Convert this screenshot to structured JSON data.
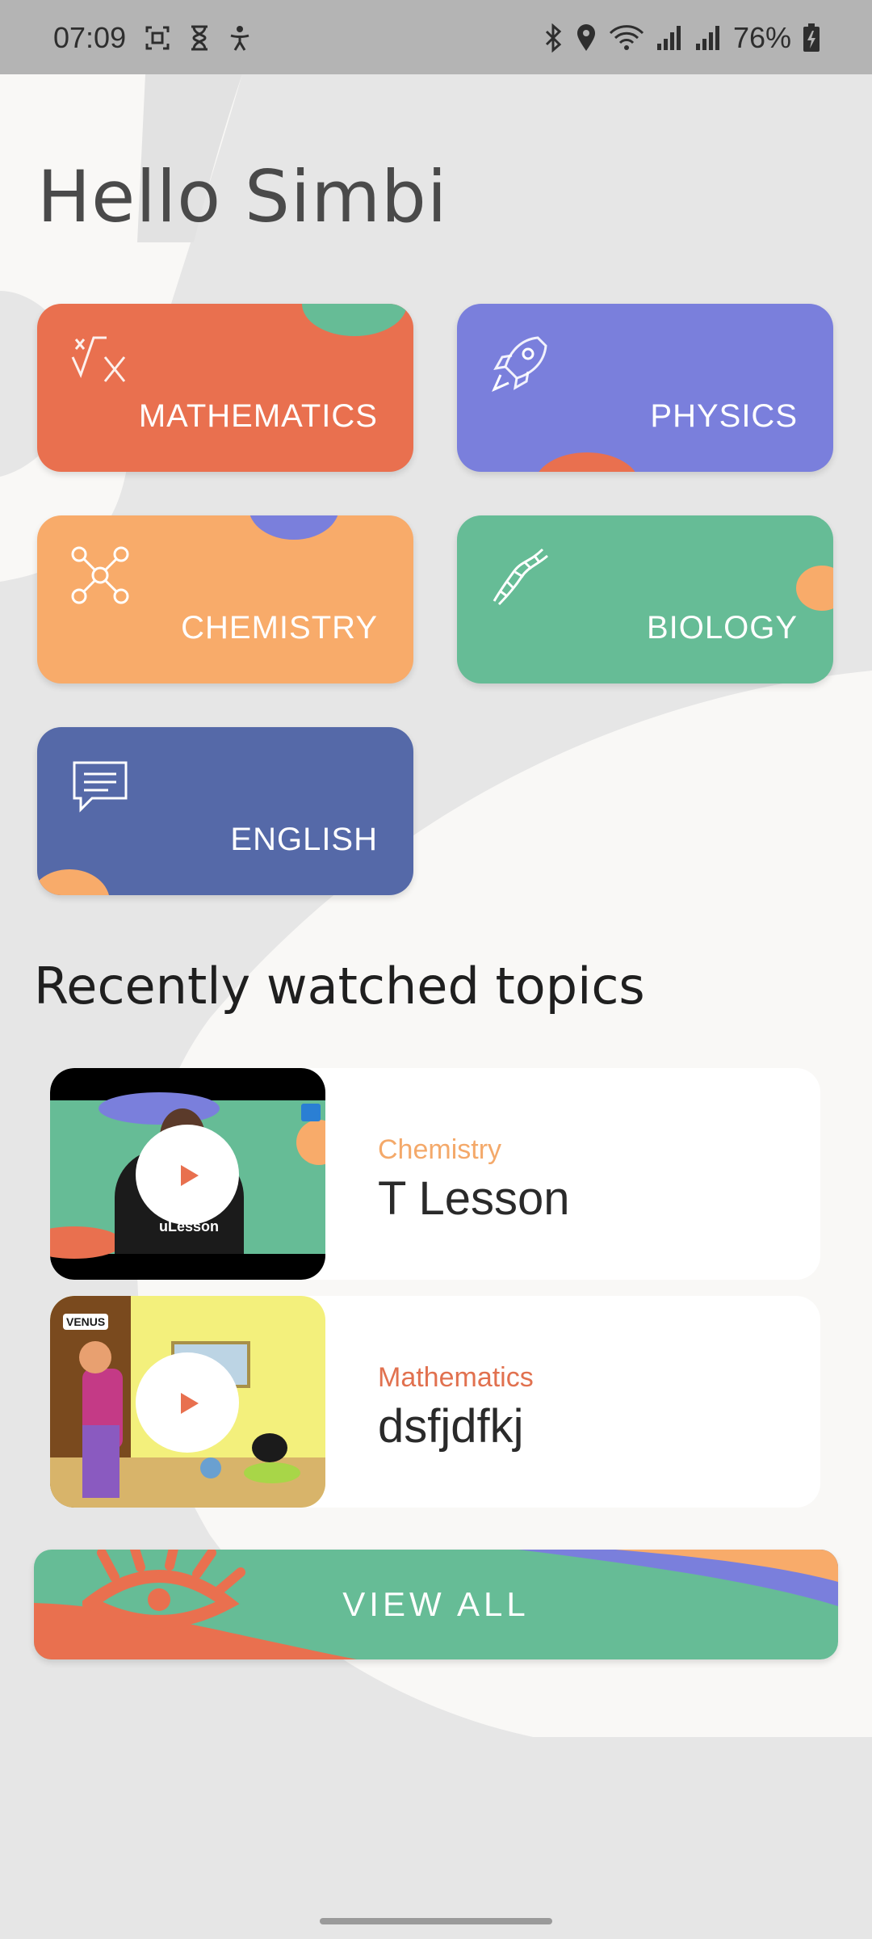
{
  "status_bar": {
    "time": "07:09",
    "battery": "76%",
    "icons": [
      "screenshot-icon",
      "hourglass-icon",
      "accessibility-icon",
      "bluetooth-icon",
      "location-icon",
      "wifi-icon",
      "signal-icon",
      "signal-icon",
      "battery-charging-icon"
    ]
  },
  "greeting": "Hello Simbi",
  "subjects": [
    {
      "label": "MATHEMATICS",
      "icon": "square-root-icon",
      "color": "#e9704f"
    },
    {
      "label": "PHYSICS",
      "icon": "rocket-icon",
      "color": "#7a7fdc"
    },
    {
      "label": "CHEMISTRY",
      "icon": "molecule-icon",
      "color": "#f8ab6a"
    },
    {
      "label": "BIOLOGY",
      "icon": "dna-icon",
      "color": "#66bc96"
    },
    {
      "label": "ENGLISH",
      "icon": "chat-icon",
      "color": "#5569a8"
    }
  ],
  "recent_section": {
    "title": "Recently watched topics",
    "items": [
      {
        "subject": "Chemistry",
        "topic": "T Lesson",
        "subject_color": "#f4a96a",
        "thumbnail_text": "uLesson"
      },
      {
        "subject": "Mathematics",
        "topic": "dsfjdfkj",
        "subject_color": "#e1714f",
        "thumbnail_text": "VENUS"
      }
    ]
  },
  "view_all_label": "VIEW ALL"
}
